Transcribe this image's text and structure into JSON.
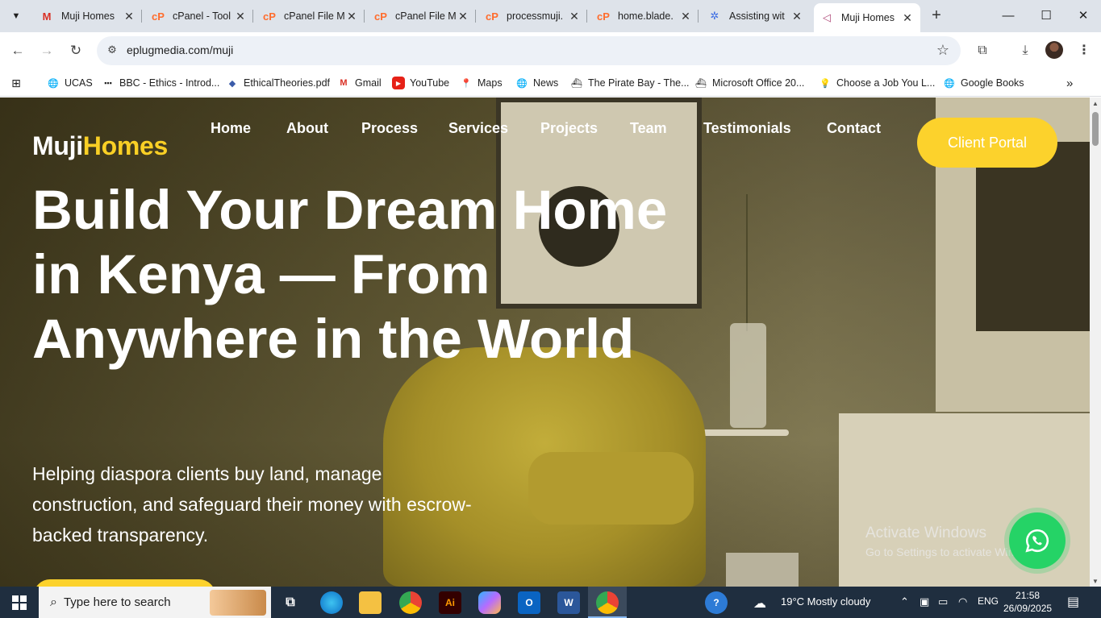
{
  "browser": {
    "tabs": [
      {
        "title": "Muji Homes",
        "icon": "gmail-icon",
        "active": false
      },
      {
        "title": "cPanel - Tool",
        "icon": "cpanel-icon",
        "active": false
      },
      {
        "title": "cPanel File M",
        "icon": "cpanel-icon",
        "active": false
      },
      {
        "title": "cPanel File M",
        "icon": "cpanel-icon",
        "active": false
      },
      {
        "title": "processmuji.",
        "icon": "cpanel-icon",
        "active": false
      },
      {
        "title": "home.blade.",
        "icon": "cpanel-icon",
        "active": false
      },
      {
        "title": "Assisting wit",
        "icon": "assistant-icon",
        "active": false
      },
      {
        "title": "Muji Homes",
        "icon": "site-icon",
        "active": true
      }
    ],
    "url": "eplugmedia.com/muji",
    "bookmarks": [
      {
        "label": "UCAS"
      },
      {
        "label": "BBC - Ethics - Introd..."
      },
      {
        "label": "EthicalTheories.pdf"
      },
      {
        "label": "Gmail"
      },
      {
        "label": "YouTube"
      },
      {
        "label": "Maps"
      },
      {
        "label": "News"
      },
      {
        "label": "The Pirate Bay - The..."
      },
      {
        "label": "Microsoft Office 20..."
      },
      {
        "label": "Choose a Job You L..."
      },
      {
        "label": "Google Books"
      }
    ]
  },
  "site": {
    "logo_primary": "Muji",
    "logo_accent": "Homes",
    "nav": [
      "Home",
      "About",
      "Process",
      "Services",
      "Projects",
      "Team",
      "Testimonials",
      "Contact"
    ],
    "portal_button": "Client Portal",
    "hero_title": "Build Your Dream Home in Kenya — From Anywhere in the World",
    "hero_subtitle": "Helping diaspora clients buy land, manage construction, and safeguard their money with escrow-backed transparency.",
    "accent_color": "#f9cf25"
  },
  "watermark": {
    "line1": "Activate Windows",
    "line2": "Go to Settings to activate Windows."
  },
  "taskbar": {
    "search_placeholder": "Type here to search",
    "weather": "19°C  Mostly cloudy",
    "language": "ENG",
    "time": "21:58",
    "date": "26/09/2025"
  }
}
